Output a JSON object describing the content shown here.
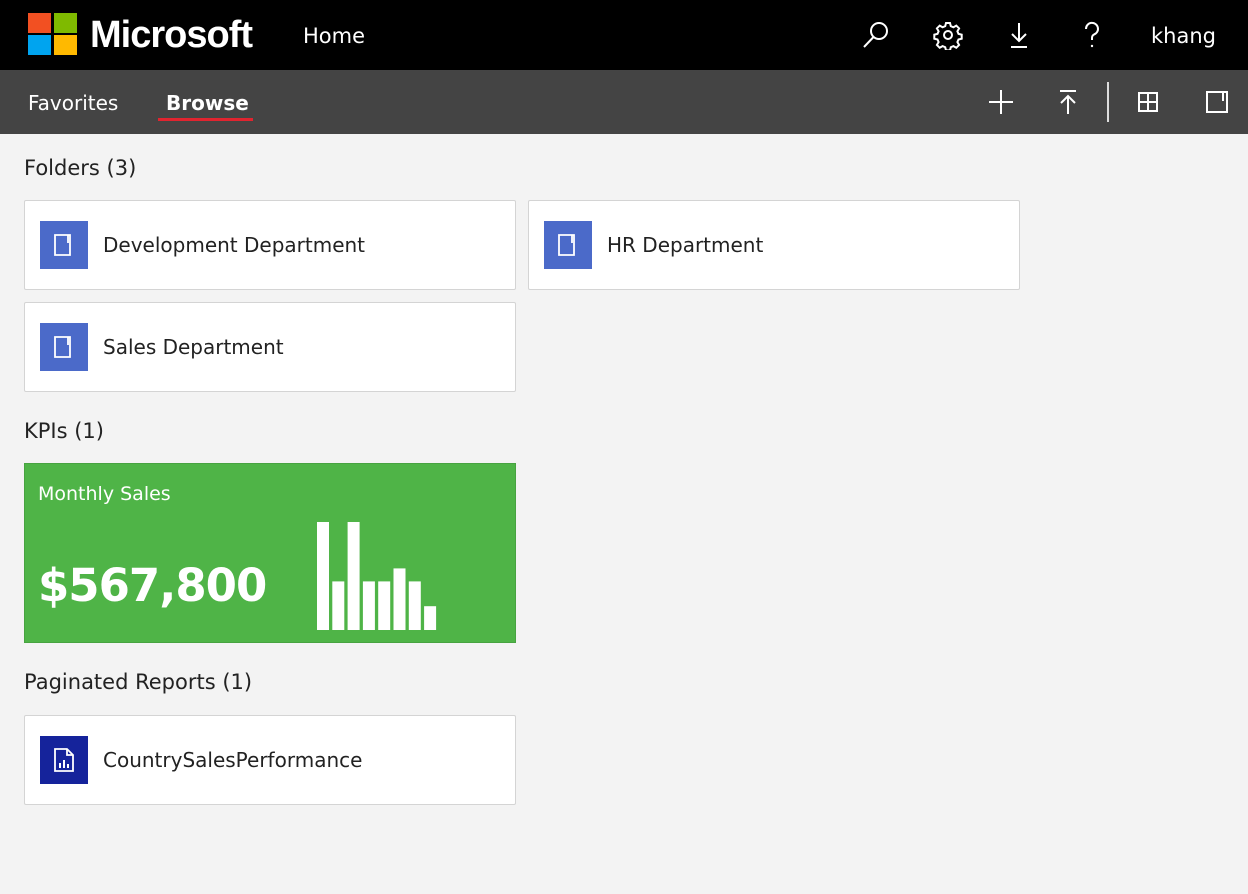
{
  "header": {
    "brand": "Microsoft",
    "home_label": "Home",
    "icons": [
      "search-icon",
      "settings-icon",
      "download-icon",
      "help-icon"
    ],
    "user": "khang"
  },
  "subnav": {
    "tabs": [
      {
        "label": "Favorites",
        "active": false
      },
      {
        "label": "Browse",
        "active": true
      }
    ],
    "icons": [
      "add-icon",
      "upload-icon",
      "tile-view-icon",
      "details-pane-icon"
    ]
  },
  "sections": {
    "folders": {
      "title": "Folders (3)",
      "items": [
        {
          "label": "Development Department"
        },
        {
          "label": "HR Department"
        },
        {
          "label": "Sales Department"
        }
      ]
    },
    "kpis": {
      "title": "KPIs (1)",
      "items": [
        {
          "title": "Monthly Sales",
          "value": "$567,800",
          "trend": [
            1.0,
            0.45,
            1.0,
            0.45,
            0.45,
            0.57,
            0.45,
            0.22
          ]
        }
      ]
    },
    "reports": {
      "title": "Paginated Reports (1)",
      "items": [
        {
          "label": "CountrySalesPerformance"
        }
      ]
    }
  },
  "colors": {
    "topbar": "#000000",
    "subbar": "#444444",
    "active_tab_underline": "#e0242f",
    "folder_tile": "#4b6ac9",
    "report_tile": "#15239b",
    "kpi_background": "#4fb447"
  }
}
